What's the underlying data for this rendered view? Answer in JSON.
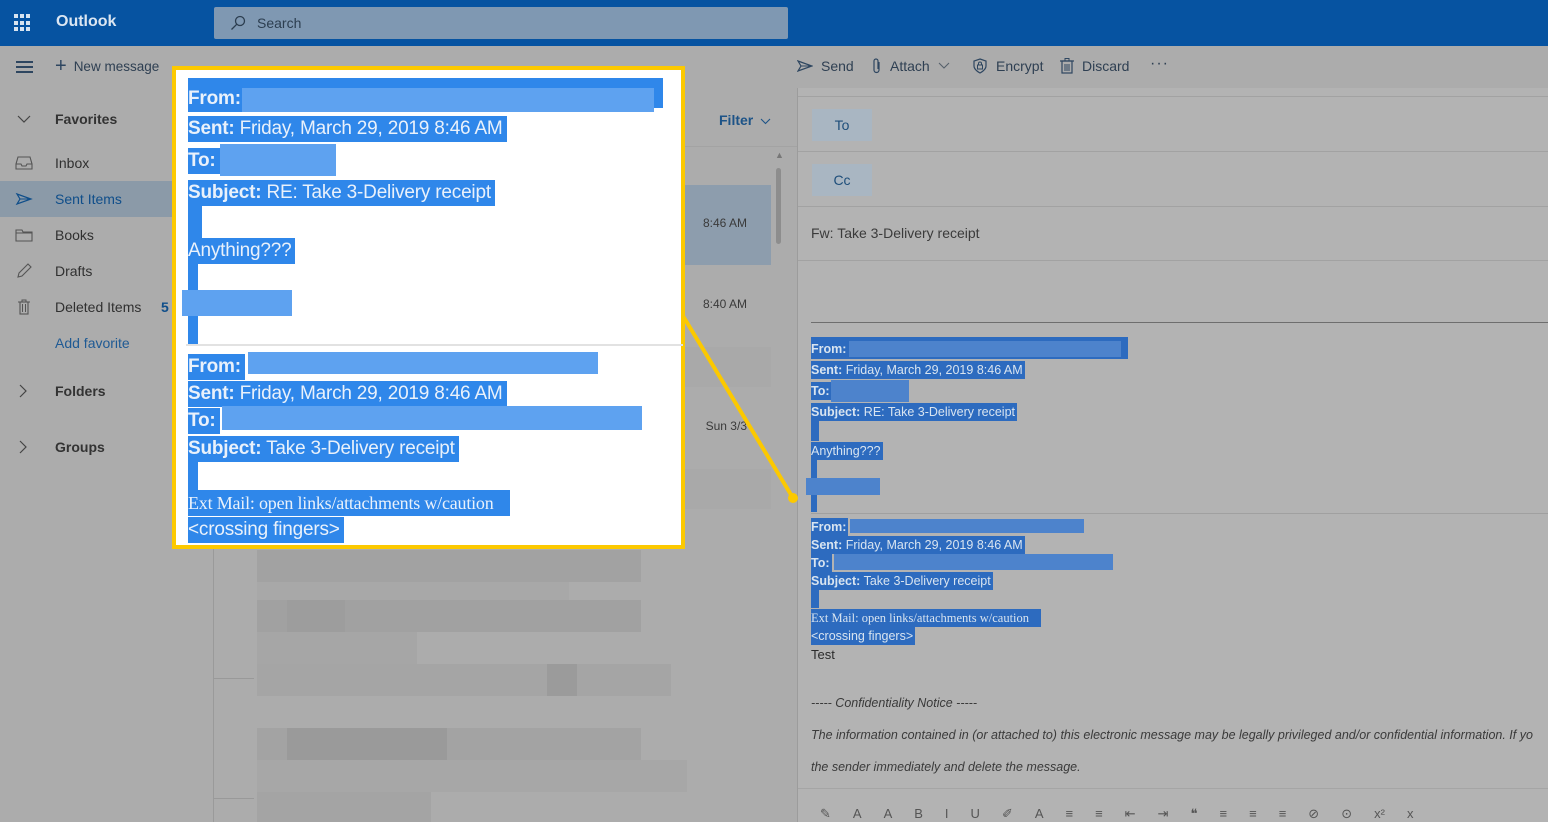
{
  "app": {
    "title": "Outlook",
    "search_placeholder": "Search"
  },
  "command_bar": {
    "new_message": "New message",
    "send": "Send",
    "attach": "Attach",
    "encrypt": "Encrypt",
    "discard": "Discard",
    "more": "···"
  },
  "nav": {
    "favorites": "Favorites",
    "items": [
      {
        "label": "Inbox",
        "icon": "inbox-icon"
      },
      {
        "label": "Sent Items",
        "icon": "send-icon",
        "selected": true
      },
      {
        "label": "Books",
        "icon": "folder-icon"
      },
      {
        "label": "Drafts",
        "icon": "pencil-icon"
      },
      {
        "label": "Deleted Items",
        "icon": "trash-icon",
        "count": "5"
      }
    ],
    "add_favorite": "Add favorite",
    "folders": "Folders",
    "groups": "Groups"
  },
  "message_list": {
    "filter": "Filter",
    "rows": [
      {
        "time": "8:46 AM",
        "selected": true
      },
      {
        "time": "8:40 AM"
      },
      {
        "time": ""
      },
      {
        "time": "Sun 3/3"
      }
    ]
  },
  "compose": {
    "to_label": "To",
    "cc_label": "Cc",
    "subject": "Fw: Take 3-Delivery receipt",
    "quoted_1": {
      "from_label": "From:",
      "sent_label": "Sent:",
      "sent_value": "Friday, March 29, 2019 8:46 AM",
      "to_label": "To:",
      "subject_label": "Subject:",
      "subject_value": "RE: Take 3-Delivery receipt",
      "body": "Anything???"
    },
    "quoted_2": {
      "from_label": "From:",
      "sent_label": "Sent:",
      "sent_value": "Friday, March 29, 2019 8:46 AM",
      "to_label": "To:",
      "subject_label": "Subject:",
      "subject_value": "Take 3-Delivery receipt",
      "warning": "Ext Mail: open links/attachments w/caution",
      "body": "<crossing fingers>"
    },
    "typed_text": "Test",
    "notice_title": "----- Confidentiality Notice -----",
    "notice_line1": "The information contained in (or attached to) this electronic message may be legally privileged and/or confidential information. If yo",
    "notice_line2": "the sender immediately and delete the message."
  },
  "format_toolbar": [
    "✎",
    "A",
    "A",
    "B",
    "I",
    "U",
    "✐",
    "A",
    "≡",
    "≡",
    "⇤",
    "⇥",
    "❝",
    "≡",
    "≡",
    "≡",
    "⊘",
    "⊙",
    "x²",
    "x"
  ],
  "callout": {
    "border_color": "#fcc900",
    "highlight_color": "#2f87ea"
  },
  "colors": {
    "topbar": "#0653a1",
    "selection": "#2d6bbf",
    "accent_text": "#0f4e8a"
  }
}
